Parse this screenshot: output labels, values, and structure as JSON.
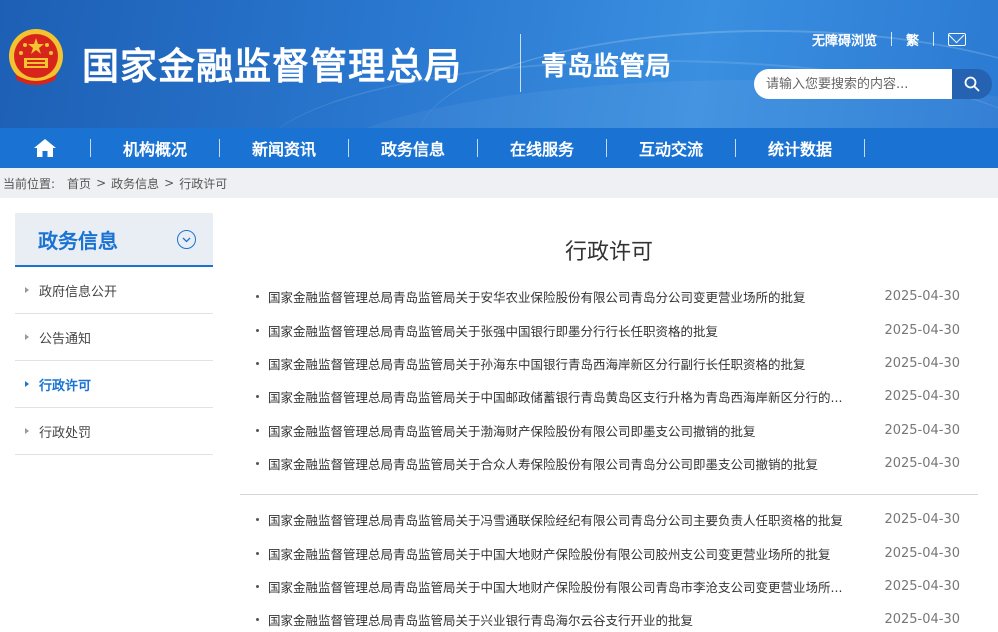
{
  "header": {
    "site_title": "国家金融监督管理总局",
    "branch_title": "青岛监管局",
    "accessibility_label": "无障碍浏览",
    "language_label": "繁",
    "search_placeholder": "请输入您要搜索的内容...",
    "colors": {
      "primary": "#1a73d3",
      "header_bg": "#2a78d0"
    }
  },
  "nav": {
    "items": [
      {
        "label": "机构概况"
      },
      {
        "label": "新闻资讯"
      },
      {
        "label": "政务信息"
      },
      {
        "label": "在线服务"
      },
      {
        "label": "互动交流"
      },
      {
        "label": "统计数据"
      }
    ]
  },
  "breadcrumb": {
    "prefix": "当前位置:",
    "items": [
      "首页",
      "政务信息",
      "行政许可"
    ],
    "separator": ">"
  },
  "sidebar": {
    "title": "政务信息",
    "items": [
      {
        "label": "政府信息公开",
        "active": false
      },
      {
        "label": "公告通知",
        "active": false
      },
      {
        "label": "行政许可",
        "active": true
      },
      {
        "label": "行政处罚",
        "active": false
      }
    ]
  },
  "main": {
    "title": "行政许可",
    "group1": [
      {
        "title": "国家金融监督管理总局青岛监管局关于安华农业保险股份有限公司青岛分公司变更营业场所的批复",
        "date": "2025-04-30"
      },
      {
        "title": "国家金融监督管理总局青岛监管局关于张强中国银行即墨分行行长任职资格的批复",
        "date": "2025-04-30"
      },
      {
        "title": "国家金融监督管理总局青岛监管局关于孙海东中国银行青岛西海岸新区分行副行长任职资格的批复",
        "date": "2025-04-30"
      },
      {
        "title": "国家金融监督管理总局青岛监管局关于中国邮政储蓄银行青岛黄岛区支行升格为青岛西海岸新区分行的...",
        "date": "2025-04-30"
      },
      {
        "title": "国家金融监督管理总局青岛监管局关于渤海财产保险股份有限公司即墨支公司撤销的批复",
        "date": "2025-04-30"
      },
      {
        "title": "国家金融监督管理总局青岛监管局关于合众人寿保险股份有限公司青岛分公司即墨支公司撤销的批复",
        "date": "2025-04-30"
      }
    ],
    "group2": [
      {
        "title": "国家金融监督管理总局青岛监管局关于冯雪通联保险经纪有限公司青岛分公司主要负责人任职资格的批复",
        "date": "2025-04-30"
      },
      {
        "title": "国家金融监督管理总局青岛监管局关于中国大地财产保险股份有限公司胶州支公司变更营业场所的批复",
        "date": "2025-04-30"
      },
      {
        "title": "国家金融监督管理总局青岛监管局关于中国大地财产保险股份有限公司青岛市李沧支公司变更营业场所...",
        "date": "2025-04-30"
      },
      {
        "title": "国家金融监督管理总局青岛监管局关于兴业银行青岛海尔云谷支行开业的批复",
        "date": "2025-04-30"
      }
    ]
  }
}
